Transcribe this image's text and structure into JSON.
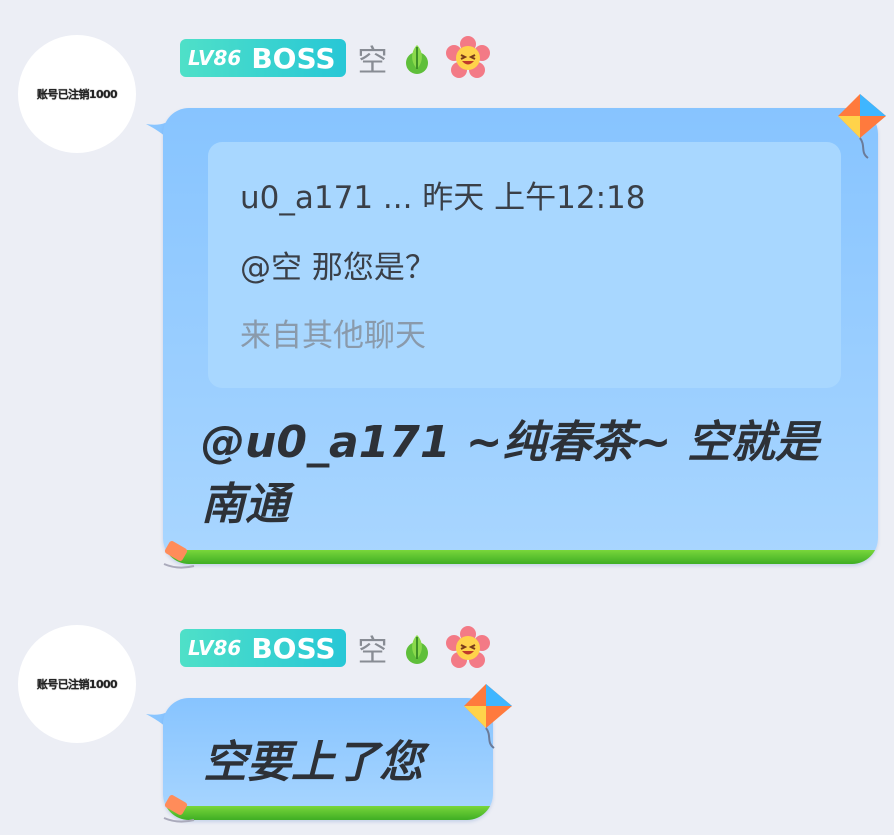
{
  "messages": [
    {
      "avatar_text": "账号已注销1000",
      "level": "LV86",
      "title": "BOSS",
      "nickname": "空",
      "quote": {
        "header": "u0_a171 ... 昨天 上午12:18",
        "text": "@空 那您是？",
        "source": "来自其他聊天"
      },
      "text": "@u0_a171 ~纯春茶~ 空就是南通"
    },
    {
      "avatar_text": "账号已注销1000",
      "level": "LV86",
      "title": "BOSS",
      "nickname": "空",
      "text": "空要上了您"
    }
  ],
  "colors": {
    "background": "#eceef5",
    "bubble": "#8fc8ff",
    "badge": "#2ccbd3",
    "grass": "#4ab52a"
  },
  "icons": [
    "sprout-icon",
    "flower-face-icon",
    "kite-icon",
    "tag-icon"
  ]
}
